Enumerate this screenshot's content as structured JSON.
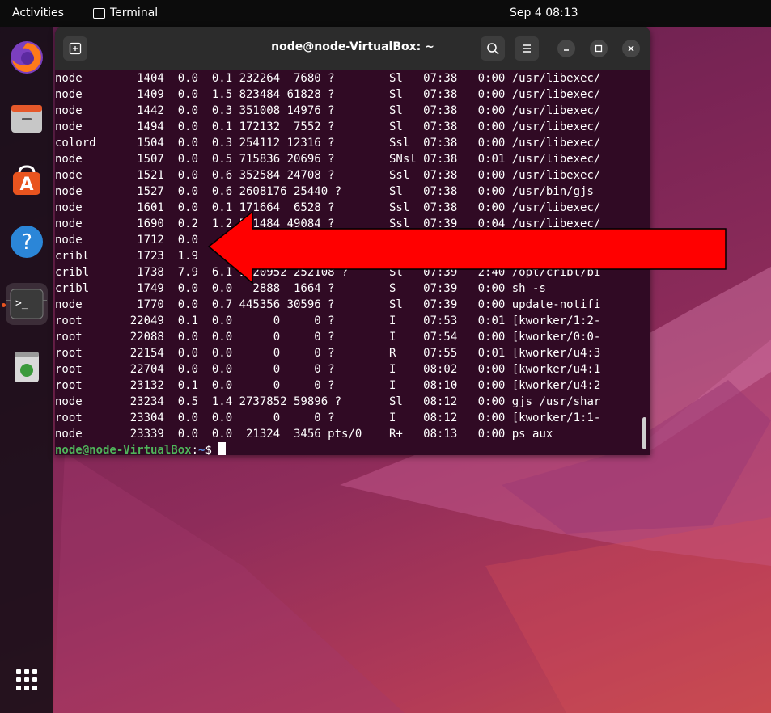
{
  "topbar": {
    "activities": "Activities",
    "app_name": "Terminal",
    "clock": "Sep 4  08:13"
  },
  "dock": {
    "items": [
      "Firefox",
      "Files",
      "Ubuntu Software",
      "Help",
      "Terminal",
      "Trash"
    ],
    "apps_grid": "Show Applications"
  },
  "terminal": {
    "title": "node@node-VirtualBox: ~",
    "lines": [
      "node        1404  0.0  0.1 232264  7680 ?        Sl   07:38   0:00 /usr/libexec/",
      "node        1409  0.0  1.5 823484 61828 ?        Sl   07:38   0:00 /usr/libexec/",
      "node        1442  0.0  0.3 351008 14976 ?        Sl   07:38   0:00 /usr/libexec/",
      "node        1494  0.0  0.1 172132  7552 ?        Sl   07:38   0:00 /usr/libexec/",
      "colord      1504  0.0  0.3 254112 12316 ?        Ssl  07:38   0:00 /usr/libexec/",
      "node        1507  0.0  0.5 715836 20696 ?        SNsl 07:38   0:01 /usr/libexec/",
      "node        1521  0.0  0.6 352584 24708 ?        Ssl  07:38   0:00 /usr/libexec/",
      "node        1527  0.0  0.6 2608176 25440 ?       Sl   07:38   0:00 /usr/bin/gjs",
      "node        1601  0.0  0.1 171664  6528 ?        Ssl  07:38   0:00 /usr/libexec/",
      "node        1690  0.2  1.2 561484 49084 ?        Ssl  07:39   0:04 /usr/libexec/",
      "node        1712  0.0",
      "cribl       1723  1.9",
      "cribl       1738  7.9  6.1 1120952 252108 ?      Sl   07:39   2:40 /opt/cribl/bi",
      "cribl       1749  0.0  0.0   2888  1664 ?        S    07:39   0:00 sh -s",
      "node        1770  0.0  0.7 445356 30596 ?        Sl   07:39   0:00 update-notifi",
      "root       22049  0.1  0.0      0     0 ?        I    07:53   0:01 [kworker/1:2-",
      "root       22088  0.0  0.0      0     0 ?        I    07:54   0:00 [kworker/0:0-",
      "root       22154  0.0  0.0      0     0 ?        R    07:55   0:01 [kworker/u4:3",
      "root       22704  0.0  0.0      0     0 ?        I    08:02   0:00 [kworker/u4:1",
      "root       23132  0.1  0.0      0     0 ?        I    08:10   0:00 [kworker/u4:2",
      "node       23234  0.5  1.4 2737852 59896 ?       Sl   08:12   0:00 gjs /usr/shar",
      "root       23304  0.0  0.0      0     0 ?        I    08:12   0:00 [kworker/1:1-",
      "node       23339  0.0  0.0  21324  3456 pts/0    R+   08:13   0:00 ps aux"
    ],
    "prompt_user": "node@node-VirtualBox",
    "prompt_sep": ":",
    "prompt_path": "~",
    "prompt_symbol": "$ "
  },
  "colors": {
    "terminal_bg": "#300a24",
    "titlebar_bg": "#2c2c2c",
    "arrow_fill": "#ff0000",
    "prompt_user": "#4fb45a",
    "accent": "#e95420"
  }
}
